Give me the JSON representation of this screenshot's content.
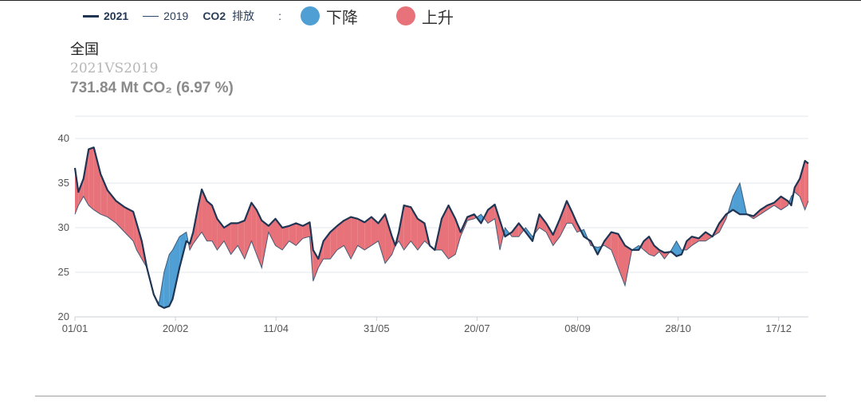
{
  "legend": {
    "line_2021": "2021",
    "line_2019": "2019",
    "co2_label": "CO2",
    "co2_sub": "排放",
    "colon": ":",
    "decrease_label": "下降",
    "increase_label": "上升"
  },
  "header": {
    "region": "全国",
    "comparison": "2021VS2019",
    "delta": "731.84 Mt CO₂ (6.97 %)"
  },
  "colors": {
    "line_2021": "#1f3553",
    "line_2019": "#2a4a6a",
    "decrease": "#4f9fd4",
    "increase": "#e8727a",
    "grid": "#e3e8ee",
    "axis": "#c9d1db"
  },
  "chart_data": {
    "type": "area",
    "title": "",
    "xlabel": "",
    "ylabel": "",
    "ylim": [
      20,
      42.5
    ],
    "yticks": [
      20,
      25,
      30,
      35,
      40
    ],
    "x_start": "01/01",
    "x_end": "31/12",
    "xticks": [
      "01/01",
      "20/02",
      "11/04",
      "31/05",
      "20/07",
      "08/09",
      "28/10",
      "17/12"
    ],
    "grid": true,
    "legend_position": "top",
    "series": [
      {
        "name": "2021",
        "points": [
          [
            1,
            36.7
          ],
          [
            3,
            34.0
          ],
          [
            6,
            35.5
          ],
          [
            9,
            38.8
          ],
          [
            12,
            39.0
          ],
          [
            16,
            36.0
          ],
          [
            20,
            34.2
          ],
          [
            25,
            33.0
          ],
          [
            30,
            32.3
          ],
          [
            35,
            31.8
          ],
          [
            37,
            30.5
          ],
          [
            40,
            28.5
          ],
          [
            43,
            25.5
          ],
          [
            47,
            22.5
          ],
          [
            50,
            21.3
          ],
          [
            53,
            21.0
          ],
          [
            56,
            21.2
          ],
          [
            58,
            22.0
          ],
          [
            62,
            25.5
          ],
          [
            66,
            28.5
          ],
          [
            68,
            28.2
          ],
          [
            70,
            29.5
          ],
          [
            73,
            32.5
          ],
          [
            75,
            34.3
          ],
          [
            78,
            33.0
          ],
          [
            81,
            32.5
          ],
          [
            84,
            31.0
          ],
          [
            88,
            30.0
          ],
          [
            92,
            30.5
          ],
          [
            96,
            30.5
          ],
          [
            100,
            30.8
          ],
          [
            104,
            32.8
          ],
          [
            107,
            32.0
          ],
          [
            110,
            30.8
          ],
          [
            114,
            30.2
          ],
          [
            118,
            31.0
          ],
          [
            122,
            30.0
          ],
          [
            126,
            30.2
          ],
          [
            130,
            30.5
          ],
          [
            134,
            30.2
          ],
          [
            138,
            30.6
          ],
          [
            140,
            27.5
          ],
          [
            143,
            26.5
          ],
          [
            146,
            28.5
          ],
          [
            150,
            29.5
          ],
          [
            154,
            30.2
          ],
          [
            158,
            30.8
          ],
          [
            162,
            31.2
          ],
          [
            166,
            31.0
          ],
          [
            170,
            30.6
          ],
          [
            174,
            31.2
          ],
          [
            178,
            30.5
          ],
          [
            182,
            31.5
          ],
          [
            186,
            29.0
          ],
          [
            188,
            28.0
          ],
          [
            190,
            29.5
          ],
          [
            193,
            32.5
          ],
          [
            197,
            32.3
          ],
          [
            201,
            31.0
          ],
          [
            205,
            30.5
          ],
          [
            208,
            28.0
          ],
          [
            211,
            27.5
          ],
          [
            215,
            31.0
          ],
          [
            219,
            32.5
          ],
          [
            223,
            31.0
          ],
          [
            226,
            29.5
          ],
          [
            230,
            31.2
          ],
          [
            234,
            31.5
          ],
          [
            238,
            30.5
          ],
          [
            242,
            32.0
          ],
          [
            246,
            32.6
          ],
          [
            249,
            30.8
          ],
          [
            252,
            29.0
          ],
          [
            256,
            29.5
          ],
          [
            260,
            30.5
          ],
          [
            264,
            29.5
          ],
          [
            268,
            28.5
          ],
          [
            272,
            31.5
          ],
          [
            276,
            30.5
          ],
          [
            280,
            29.2
          ],
          [
            284,
            31.0
          ],
          [
            288,
            33.0
          ],
          [
            291,
            31.8
          ],
          [
            294,
            30.5
          ],
          [
            298,
            29.0
          ],
          [
            302,
            28.5
          ],
          [
            306,
            27.0
          ],
          [
            310,
            28.5
          ],
          [
            314,
            29.5
          ],
          [
            318,
            29.3
          ],
          [
            322,
            28.0
          ],
          [
            326,
            27.5
          ],
          [
            330,
            27.5
          ],
          [
            333,
            28.5
          ],
          [
            336,
            29.0
          ],
          [
            339,
            28.0
          ],
          [
            342,
            27.5
          ],
          [
            345,
            27.2
          ],
          [
            349,
            27.3
          ],
          [
            352,
            26.8
          ],
          [
            355,
            27.0
          ],
          [
            358,
            28.5
          ],
          [
            361,
            29.0
          ],
          [
            365,
            28.8
          ],
          [
            369,
            29.5
          ],
          [
            373,
            29.0
          ],
          [
            377,
            30.5
          ],
          [
            381,
            31.5
          ],
          [
            385,
            32.0
          ],
          [
            389,
            31.5
          ],
          [
            393,
            31.5
          ],
          [
            397,
            31.3
          ],
          [
            401,
            32.0
          ],
          [
            405,
            32.5
          ],
          [
            409,
            32.8
          ],
          [
            413,
            33.5
          ],
          [
            417,
            33.0
          ],
          [
            419,
            32.5
          ],
          [
            421,
            34.5
          ],
          [
            424,
            35.5
          ],
          [
            427,
            37.5
          ],
          [
            429,
            37.2
          ]
        ]
      },
      {
        "name": "2019",
        "points": [
          [
            1,
            31.5
          ],
          [
            3,
            32.5
          ],
          [
            6,
            33.5
          ],
          [
            9,
            32.5
          ],
          [
            12,
            32.0
          ],
          [
            16,
            31.5
          ],
          [
            20,
            31.2
          ],
          [
            25,
            30.5
          ],
          [
            30,
            29.5
          ],
          [
            35,
            28.5
          ],
          [
            37,
            27.5
          ],
          [
            40,
            26.5
          ],
          [
            43,
            25.5
          ],
          [
            47,
            22.5
          ],
          [
            50,
            21.5
          ],
          [
            53,
            25.0
          ],
          [
            56,
            27.0
          ],
          [
            58,
            27.5
          ],
          [
            62,
            29.0
          ],
          [
            66,
            29.5
          ],
          [
            68,
            27.5
          ],
          [
            70,
            28.2
          ],
          [
            73,
            29.0
          ],
          [
            75,
            29.5
          ],
          [
            78,
            28.5
          ],
          [
            81,
            28.5
          ],
          [
            84,
            27.5
          ],
          [
            88,
            28.5
          ],
          [
            92,
            27.0
          ],
          [
            96,
            28.0
          ],
          [
            100,
            26.5
          ],
          [
            104,
            28.5
          ],
          [
            107,
            27.0
          ],
          [
            110,
            25.5
          ],
          [
            114,
            29.5
          ],
          [
            118,
            28.0
          ],
          [
            122,
            27.5
          ],
          [
            126,
            28.5
          ],
          [
            130,
            28.0
          ],
          [
            134,
            28.8
          ],
          [
            138,
            29.0
          ],
          [
            140,
            24.0
          ],
          [
            143,
            25.5
          ],
          [
            146,
            26.5
          ],
          [
            150,
            26.5
          ],
          [
            154,
            27.5
          ],
          [
            158,
            28.0
          ],
          [
            162,
            26.5
          ],
          [
            166,
            28.0
          ],
          [
            170,
            27.5
          ],
          [
            174,
            28.0
          ],
          [
            178,
            28.5
          ],
          [
            182,
            26.0
          ],
          [
            186,
            27.0
          ],
          [
            188,
            28.0
          ],
          [
            190,
            28.5
          ],
          [
            193,
            27.5
          ],
          [
            197,
            28.5
          ],
          [
            201,
            27.5
          ],
          [
            205,
            28.5
          ],
          [
            208,
            28.0
          ],
          [
            211,
            27.5
          ],
          [
            215,
            27.5
          ],
          [
            219,
            26.5
          ],
          [
            223,
            27.0
          ],
          [
            226,
            29.0
          ],
          [
            230,
            30.8
          ],
          [
            234,
            31.0
          ],
          [
            238,
            31.5
          ],
          [
            242,
            30.5
          ],
          [
            246,
            31.0
          ],
          [
            249,
            27.5
          ],
          [
            252,
            30.0
          ],
          [
            256,
            29.0
          ],
          [
            260,
            29.0
          ],
          [
            264,
            30.0
          ],
          [
            268,
            29.0
          ],
          [
            272,
            30.0
          ],
          [
            276,
            29.5
          ],
          [
            280,
            28.0
          ],
          [
            284,
            29.0
          ],
          [
            288,
            30.5
          ],
          [
            291,
            30.5
          ],
          [
            294,
            29.5
          ],
          [
            298,
            29.8
          ],
          [
            302,
            28.0
          ],
          [
            306,
            27.8
          ],
          [
            310,
            28.0
          ],
          [
            314,
            27.5
          ],
          [
            318,
            25.5
          ],
          [
            322,
            23.5
          ],
          [
            326,
            27.5
          ],
          [
            330,
            28.0
          ],
          [
            333,
            27.5
          ],
          [
            336,
            27.0
          ],
          [
            339,
            26.8
          ],
          [
            342,
            27.3
          ],
          [
            345,
            26.5
          ],
          [
            349,
            27.5
          ],
          [
            352,
            28.5
          ],
          [
            355,
            27.5
          ],
          [
            358,
            27.5
          ],
          [
            361,
            28.0
          ],
          [
            365,
            28.5
          ],
          [
            369,
            28.5
          ],
          [
            373,
            29.0
          ],
          [
            377,
            29.5
          ],
          [
            381,
            31.0
          ],
          [
            385,
            33.5
          ],
          [
            389,
            35.0
          ],
          [
            393,
            31.5
          ],
          [
            397,
            31.0
          ],
          [
            401,
            31.5
          ],
          [
            405,
            32.0
          ],
          [
            409,
            32.5
          ],
          [
            413,
            32.0
          ],
          [
            417,
            32.5
          ],
          [
            419,
            33.5
          ],
          [
            421,
            34.0
          ],
          [
            424,
            33.5
          ],
          [
            427,
            32.0
          ],
          [
            429,
            33.0
          ]
        ]
      }
    ]
  }
}
